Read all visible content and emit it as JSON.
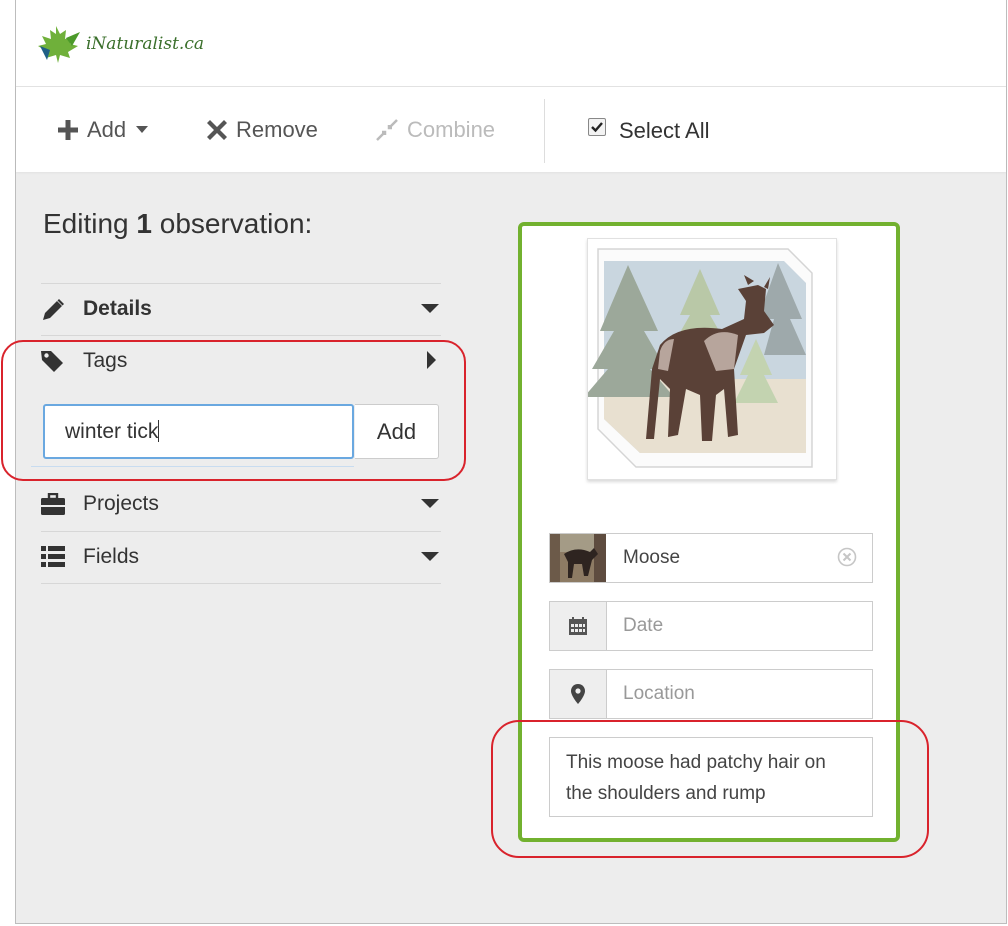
{
  "logo": {
    "text": "iNaturalist.ca"
  },
  "toolbar": {
    "add_label": "Add",
    "remove_label": "Remove",
    "combine_label": "Combine",
    "select_all_label": "Select All",
    "select_all_checked": true
  },
  "editing": {
    "prefix": "Editing",
    "count": "1",
    "suffix": "observation:"
  },
  "sections": {
    "details": "Details",
    "tags": "Tags",
    "projects": "Projects",
    "fields": "Fields"
  },
  "tags": {
    "input_value": "winter tick",
    "add_button": "Add"
  },
  "observation": {
    "species_value": "Moose",
    "date_placeholder": "Date",
    "location_placeholder": "Location",
    "notes": "This moose had patchy hair on the shoulders and rump"
  },
  "colors": {
    "card_border": "#72b12f",
    "highlight_oval": "#d9232c",
    "input_focus": "#6aa8e0"
  }
}
